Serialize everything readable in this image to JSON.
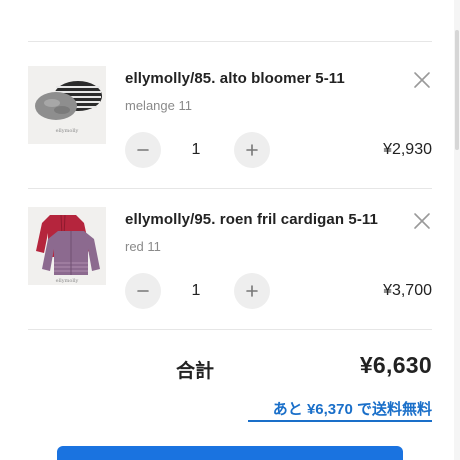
{
  "cart": {
    "items": [
      {
        "name": "ellymolly/85. alto bloomer 5-11",
        "variant": "melange 11",
        "quantity": "1",
        "price": "¥2,930",
        "thumb_brand": "ellymolly"
      },
      {
        "name": "ellymolly/95. roen fril cardigan 5-11",
        "variant": "red 11",
        "quantity": "1",
        "price": "¥3,700",
        "thumb_brand": "ellymolly"
      }
    ],
    "total_label": "合計",
    "total_value": "¥6,630",
    "free_shipping_notice": "あと ¥6,370 で送料無料"
  },
  "icons": {
    "remove": "close-icon",
    "decrease": "minus-icon",
    "increase": "plus-icon"
  },
  "colors": {
    "accent": "#1a6fc9",
    "checkout_button": "#1a73e0",
    "qty_button_bg": "#eeeeee",
    "muted_text": "#8a8a8a"
  }
}
